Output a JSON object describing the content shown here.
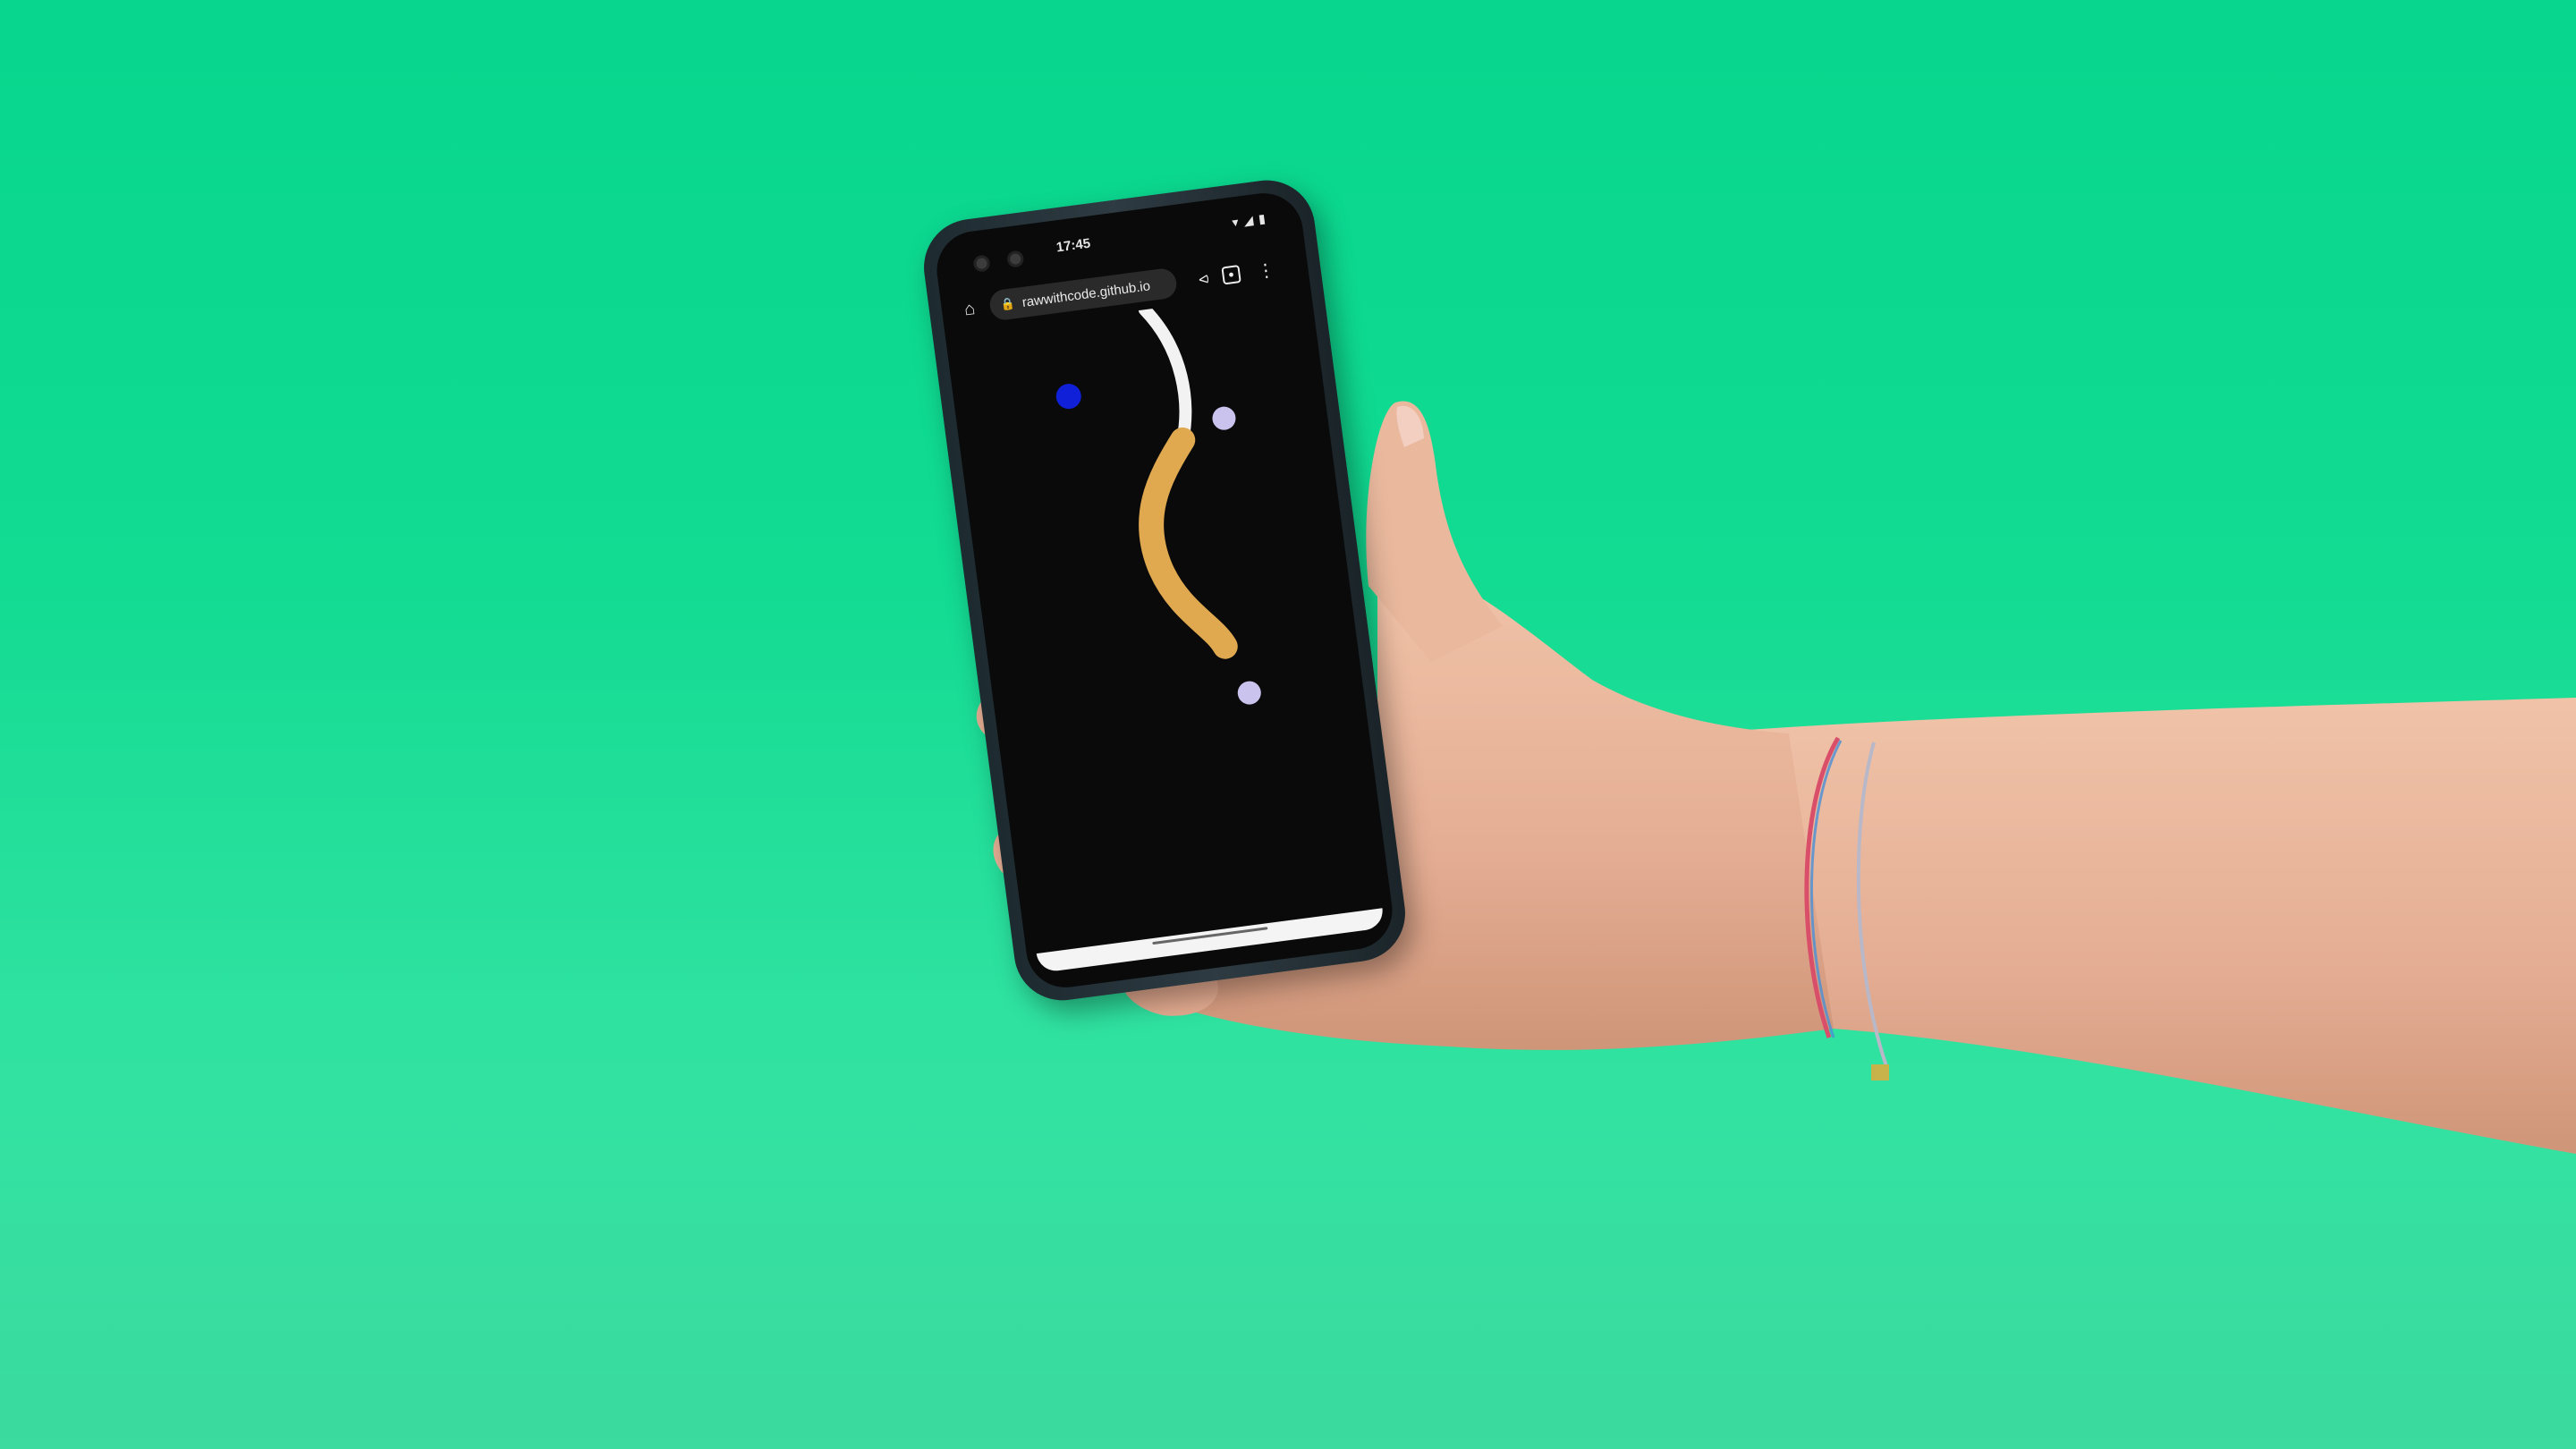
{
  "status_bar": {
    "time": "17:45",
    "icons": [
      "wifi-icon",
      "signal-icon",
      "battery-icon"
    ]
  },
  "browser": {
    "url": "rawwithcode.github.io",
    "icons": [
      "home-icon",
      "lock-icon",
      "share-icon",
      "tabs-icon",
      "menu-icon"
    ]
  },
  "canvas": {
    "background": "#0a0a0a",
    "worm_head_color": "#f2f2f2",
    "worm_body_color": "#e0a94f",
    "dot_colors": [
      "#1020d8",
      "#c9c3ee",
      "#c9c3ee"
    ]
  },
  "colors": {
    "backdrop": "#10d890",
    "skin": "#e8b49a"
  }
}
